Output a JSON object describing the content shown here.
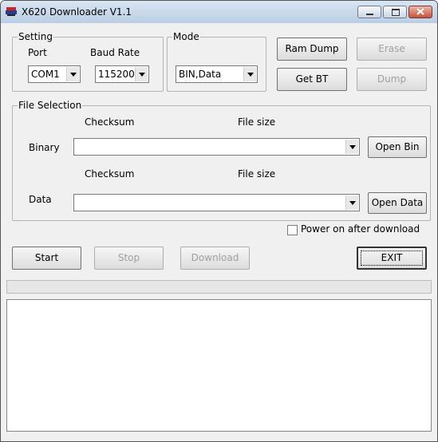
{
  "window": {
    "title": "X620 Downloader V1.1"
  },
  "setting": {
    "legend": "Setting",
    "port_label": "Port",
    "baud_label": "Baud Rate",
    "port_value": "COM1",
    "baud_value": "115200"
  },
  "mode": {
    "legend": "Mode",
    "value": "BIN,Data"
  },
  "buttons": {
    "ram_dump": "Ram Dump",
    "erase": "Erase",
    "get_bt": "Get BT",
    "dump": "Dump",
    "open_bin": "Open Bin",
    "open_data": "Open Data",
    "start": "Start",
    "stop": "Stop",
    "download": "Download",
    "exit": "EXIT"
  },
  "file_selection": {
    "legend": "File Selection",
    "checksum_label": "Checksum",
    "filesize_label": "File size",
    "binary_label": "Binary",
    "data_label": "Data",
    "binary_value": "",
    "data_value": ""
  },
  "power_option": {
    "label": "Power on after download",
    "checked": false
  },
  "progress": {
    "value": 0
  }
}
